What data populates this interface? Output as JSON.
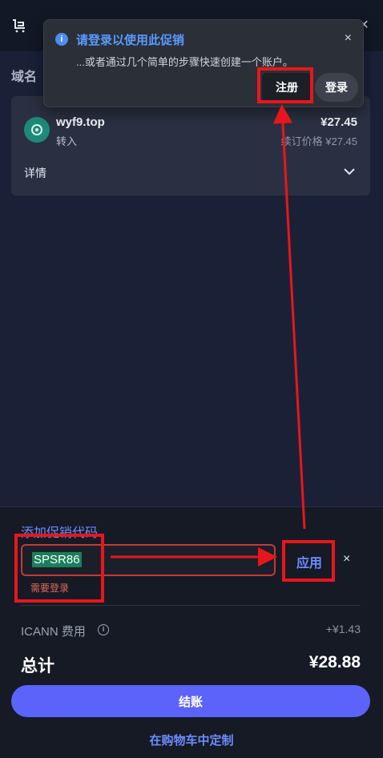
{
  "topbar": {
    "close_glyph": "×"
  },
  "section": {
    "label": "域名"
  },
  "domain_item": {
    "name": "wyf9.top",
    "action": "转入",
    "price": "¥27.45",
    "renew_price": "续订价格 ¥27.45",
    "details_label": "详情"
  },
  "toast": {
    "title": "请登录以使用此促销",
    "body": "...或者通过几个简单的步骤快速创建一个账户。",
    "register_label": "注册",
    "login_label": "登录",
    "close_glyph": "×",
    "info_glyph": "i"
  },
  "promo": {
    "title": "添加促销代码",
    "value": "SPSR86",
    "error": "需要登录",
    "apply_label": "应用",
    "clear_glyph": "×"
  },
  "summary": {
    "icann_label": "ICANN 费用",
    "icann_info_glyph": "i",
    "icann_fee": "+¥1.43",
    "total_label": "总计",
    "total_value": "¥28.88"
  },
  "actions": {
    "checkout_label": "结账",
    "customize_label": "在购物车中定制"
  },
  "colors": {
    "accent": "#5b63fa",
    "link": "#6c8cff",
    "annotation_red": "#e8161c",
    "error": "#e06a5f"
  },
  "icons": [
    "cart-icon",
    "close-icon",
    "domain-avatar-icon",
    "chevron-down-icon",
    "info-icon"
  ]
}
